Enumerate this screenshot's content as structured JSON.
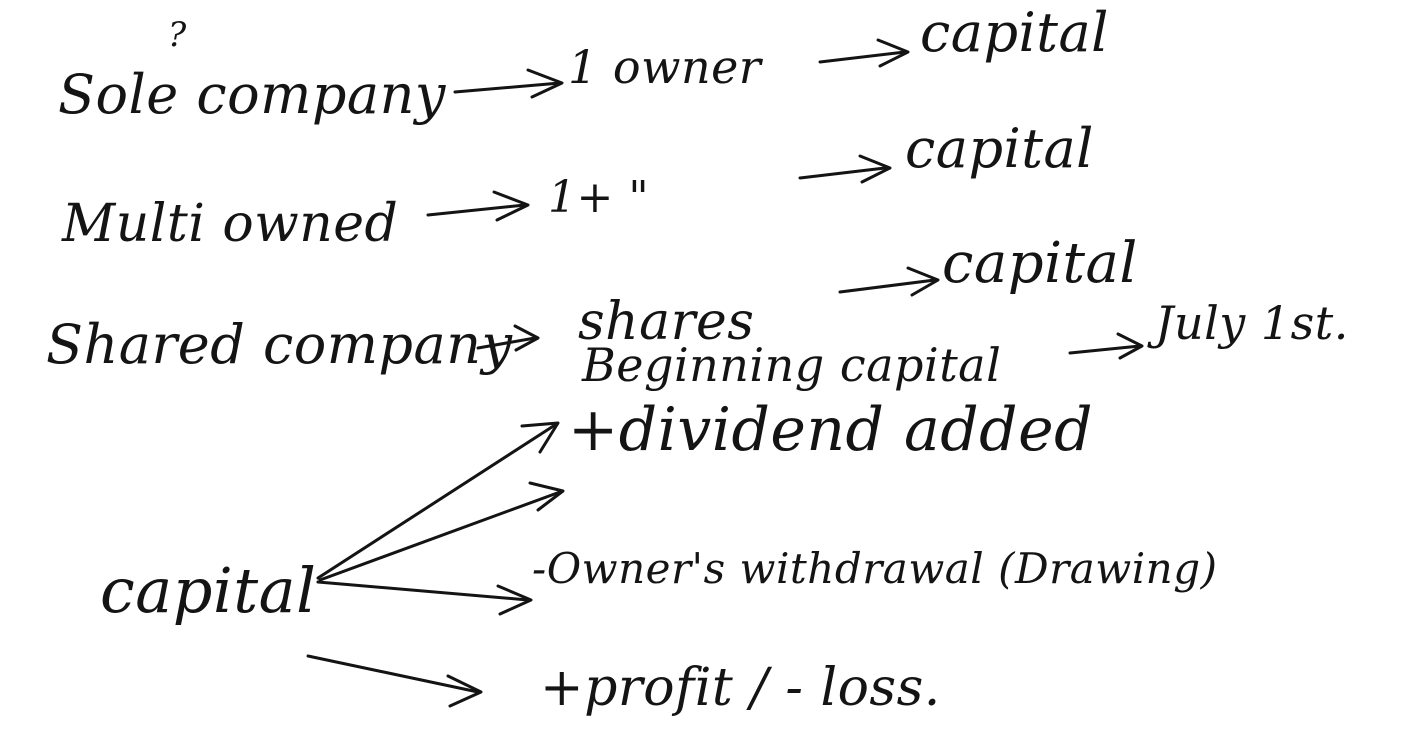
{
  "notes": {
    "line1": {
      "mark": "?",
      "term": "Sole company",
      "desc": "1 owner",
      "result": "capital"
    },
    "line2": {
      "term": "Multi owned",
      "desc": "1+ \"",
      "result": "capital"
    },
    "line3": {
      "term": "Shared company",
      "desc": "shares",
      "result": "capital"
    },
    "line4": {
      "term": "Beginning capital",
      "result": "July 1st."
    },
    "capital_tree": {
      "root": "capital",
      "branches": [
        "+dividend added",
        "-Owner's withdrawal (Drawing)",
        "+profit / - loss."
      ]
    }
  }
}
